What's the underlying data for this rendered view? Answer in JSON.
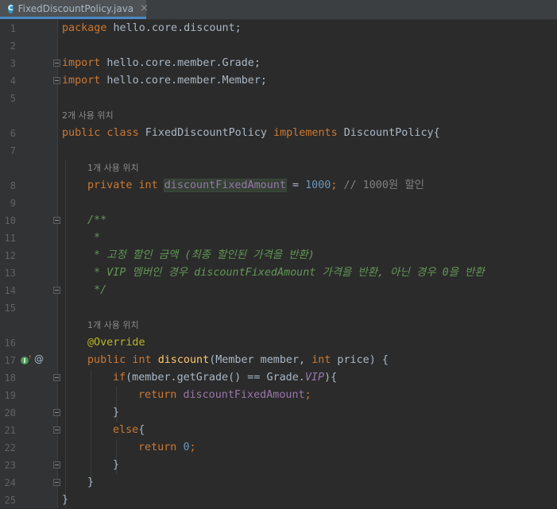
{
  "tab": {
    "icon": "C",
    "title": "FixedDiscountPolicy.java",
    "close": "×"
  },
  "hints": {
    "class_usage": "2개 사용 위치",
    "field_usage": "1개 사용 위치",
    "method_usage": "1개 사용 위치"
  },
  "gutter_icons": {
    "implements_icon": "I",
    "override_marker": "@"
  },
  "code": {
    "l1": {
      "kw": "package",
      "rest": " hello.core.discount;"
    },
    "l3": {
      "kw": "import",
      "rest": " hello.core.member.Grade;"
    },
    "l4": {
      "kw": "import",
      "rest": " hello.core.member.Member;"
    },
    "l6": {
      "kw1": "public class",
      "name": " FixedDiscountPolicy ",
      "kw2": "implements",
      "rest": " DiscountPolicy{"
    },
    "l8": {
      "kw": "private int",
      "sp": " ",
      "field": "discountFixedAmount",
      "eq": " = ",
      "num": "1000",
      "semi": "; ",
      "cmt": "// 1000원 할인"
    },
    "l10": "/**",
    "l11": " *",
    "l12": " * 고정 할인 금액 (최종 할인된 가격을 반환)",
    "l13": " * VIP 멤버인 경우 discountFixedAmount 가격을 반환, 아닌 경우 0을 반환",
    "l14": " */",
    "l16": "@Override",
    "l17": {
      "kw1": "public int",
      "sp": " ",
      "fn": "discount",
      "p1": "(Member member, ",
      "kw2": "int",
      "p2": " price) {"
    },
    "l18": {
      "kw": "if",
      "a": "(member.getGrade() == Grade.",
      "field": "VIP",
      "b": "){"
    },
    "l19": {
      "kw": "return",
      "sp": " ",
      "field": "discountFixedAmount",
      "semi": ";"
    },
    "l20": "}",
    "l21": {
      "kw": "else",
      "rest": "{"
    },
    "l22": {
      "kw": "return",
      "sp": " ",
      "num": "0",
      "semi": ";"
    },
    "l23": "}",
    "l24": "}",
    "l25": "}"
  },
  "line_numbers": [
    "1",
    "2",
    "3",
    "4",
    "5",
    "6",
    "7",
    "8",
    "9",
    "10",
    "11",
    "12",
    "13",
    "14",
    "15",
    "16",
    "17",
    "18",
    "19",
    "20",
    "21",
    "22",
    "23",
    "24",
    "25"
  ]
}
